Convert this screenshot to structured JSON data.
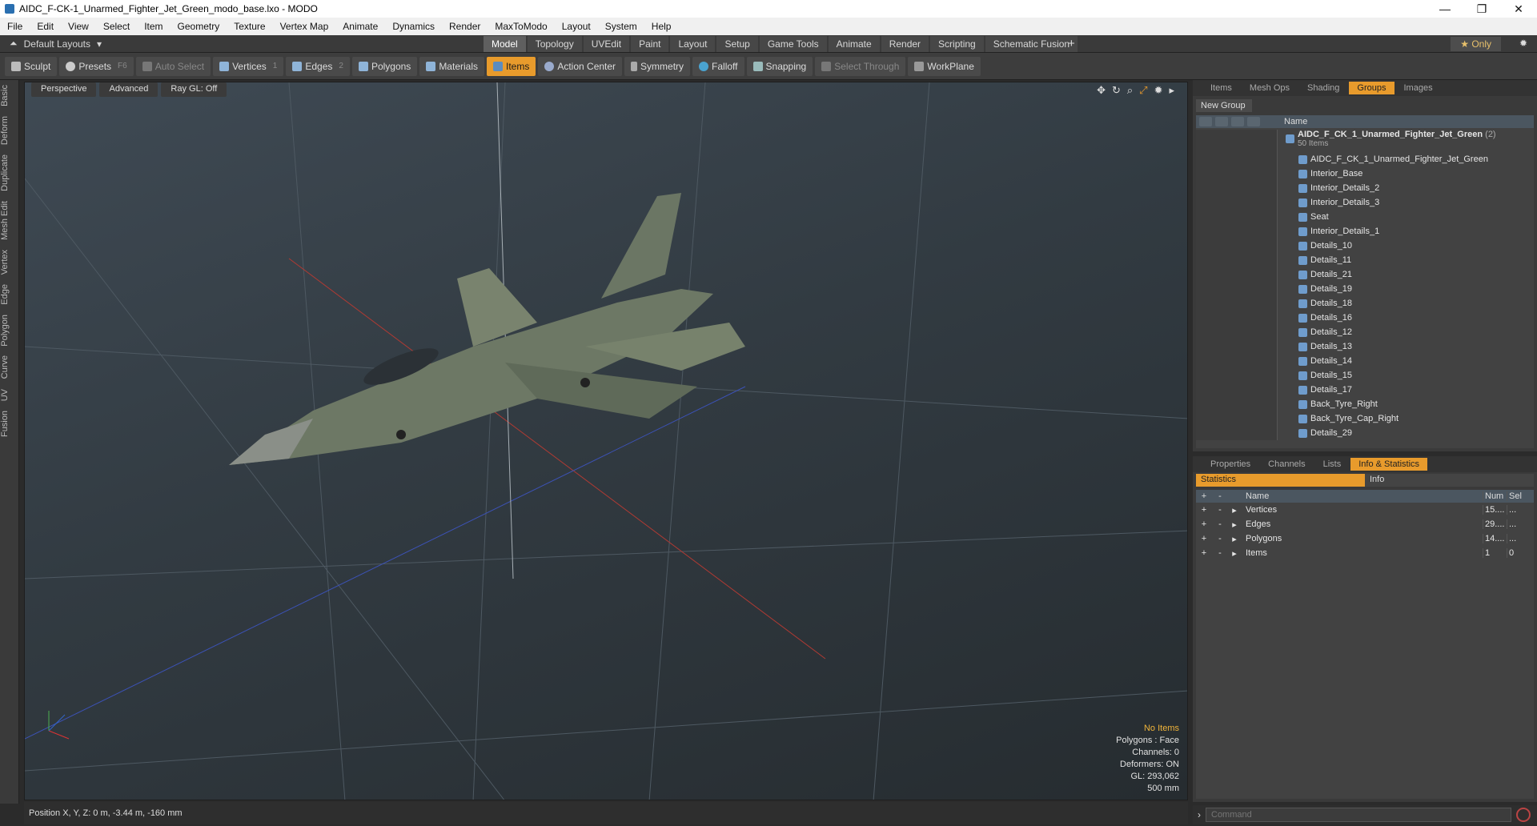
{
  "window": {
    "title": "AIDC_F-CK-1_Unarmed_Fighter_Jet_Green_modo_base.lxo - MODO"
  },
  "menu": [
    "File",
    "Edit",
    "View",
    "Select",
    "Item",
    "Geometry",
    "Texture",
    "Vertex Map",
    "Animate",
    "Dynamics",
    "Render",
    "MaxToModo",
    "Layout",
    "System",
    "Help"
  ],
  "layouts": {
    "label": "Default Layouts"
  },
  "mode_tabs": [
    {
      "label": "Model",
      "active": true
    },
    {
      "label": "Topology"
    },
    {
      "label": "UVEdit"
    },
    {
      "label": "Paint"
    },
    {
      "label": "Layout"
    },
    {
      "label": "Setup"
    },
    {
      "label": "Game Tools"
    },
    {
      "label": "Animate"
    },
    {
      "label": "Render"
    },
    {
      "label": "Scripting"
    },
    {
      "label": "Schematic Fusion"
    }
  ],
  "only_label": "Only",
  "toolbar": {
    "sculpt": "Sculpt",
    "presets": "Presets",
    "presets_key": "F6",
    "auto_select": "Auto Select",
    "vertices": "Vertices",
    "vertices_key": "1",
    "edges": "Edges",
    "edges_key": "2",
    "polygons": "Polygons",
    "materials": "Materials",
    "items": "Items",
    "action_center": "Action Center",
    "symmetry": "Symmetry",
    "falloff": "Falloff",
    "snapping": "Snapping",
    "select_through": "Select Through",
    "workplane": "WorkPlane"
  },
  "left_tabs": [
    "Basic",
    "Deform",
    "Duplicate",
    "Mesh Edit",
    "Vertex",
    "Edge",
    "Polygon",
    "Curve",
    "UV",
    "Fusion"
  ],
  "viewport": {
    "perspective": "Perspective",
    "advanced": "Advanced",
    "raygl": "Ray GL: Off",
    "info": {
      "no_items": "No Items",
      "polygons": "Polygons : Face",
      "channels": "Channels: 0",
      "deformers": "Deformers: ON",
      "gl": "GL: 293,062",
      "scale": "500 mm"
    }
  },
  "status": "Position X, Y, Z:  0 m, -3.44 m, -160 mm",
  "groups_panel": {
    "tabs": [
      {
        "label": "Items"
      },
      {
        "label": "Mesh Ops"
      },
      {
        "label": "Shading"
      },
      {
        "label": "Groups",
        "active": true
      },
      {
        "label": "Images"
      }
    ],
    "new_group": "New Group",
    "name_header": "Name",
    "root": {
      "name": "AIDC_F_CK_1_Unarmed_Fighter_Jet_Green",
      "count": "(2)",
      "sub": "50 Items"
    },
    "items": [
      "AIDC_F_CK_1_Unarmed_Fighter_Jet_Green",
      "Interior_Base",
      "Interior_Details_2",
      "Interior_Details_3",
      "Seat",
      "Interior_Details_1",
      "Details_10",
      "Details_11",
      "Details_21",
      "Details_19",
      "Details_18",
      "Details_16",
      "Details_12",
      "Details_13",
      "Details_14",
      "Details_15",
      "Details_17",
      "Back_Tyre_Right",
      "Back_Tyre_Cap_Right",
      "Details_29"
    ]
  },
  "stats_panel": {
    "tabs": [
      {
        "label": "Properties"
      },
      {
        "label": "Channels"
      },
      {
        "label": "Lists"
      },
      {
        "label": "Info & Statistics",
        "active": true
      }
    ],
    "sub_tabs": [
      {
        "label": "Statistics",
        "active": true
      },
      {
        "label": "Info"
      }
    ],
    "headers": {
      "name": "Name",
      "num": "Num",
      "sel": "Sel"
    },
    "rows": [
      {
        "name": "Vertices",
        "num": "15....",
        "sel": "..."
      },
      {
        "name": "Edges",
        "num": "29....",
        "sel": "..."
      },
      {
        "name": "Polygons",
        "num": "14....",
        "sel": "..."
      },
      {
        "name": "Items",
        "num": "1",
        "sel": "0"
      }
    ]
  },
  "command": {
    "placeholder": "Command"
  },
  "colors": {
    "accent": "#e89b2c",
    "viewport_bg": "#323b42"
  }
}
